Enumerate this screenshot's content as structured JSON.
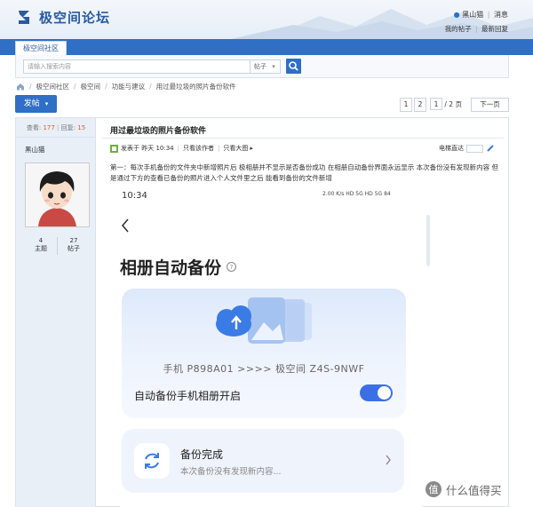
{
  "site": {
    "name": "极空间论坛",
    "brand_color": "#2f6fc5"
  },
  "user": {
    "name": "黑山猫",
    "messages_label": "消息",
    "my_posts_label": "我的帖子",
    "latest_replies_label": "最新回复"
  },
  "nav": {
    "tab_label": "极空间社区"
  },
  "search": {
    "placeholder": "请输入搜索内容",
    "scope": "帖子"
  },
  "breadcrumb": [
    "极空间社区",
    "极空间",
    "功能与建议",
    "用过最垃圾的照片备份软件"
  ],
  "toolbar": {
    "post_button": "发帖"
  },
  "pagination": {
    "page1": "1",
    "page2": "2",
    "current": "1",
    "total": "/ 2 页",
    "next": "下一页"
  },
  "thread": {
    "stats": {
      "views_label": "查看:",
      "views": "177",
      "sep": "|",
      "replies_label": "回复:",
      "replies": "15"
    },
    "author": {
      "name": "黑山猫",
      "topics": "4",
      "topics_label": "主题",
      "posts": "27",
      "posts_label": "帖子"
    },
    "title": "用过最垃圾的照片备份软件",
    "meta": {
      "posted": "发表于 昨天 10:34",
      "only_author": "只看该作者",
      "large_image": "只看大图"
    },
    "ebook_label": "电梯直达",
    "body": "第一：每次手机备份的文件夹中新增照片后 极相册并不显示是否备份成功 在相册自动备份界面永远显示 本次备份没有发现新内容 但是通过下方的查看已备份的照片进入个人文件里之后 能看到备份的文件新增"
  },
  "screenshot": {
    "time": "10:34",
    "status": "2.00 K/s  HD  5G  HD  5G  84",
    "page_title": "相册自动备份",
    "route": "手机 P898A01 >>>> 极空间 Z4S-9NWF",
    "toggle_label": "自动备份手机相册开启",
    "toggle_on": true,
    "toggle_color": "#3d6fe4",
    "done_title": "备份完成",
    "done_sub": "本次备份没有发现新内容..."
  },
  "watermark": {
    "text": "什么值得买"
  }
}
